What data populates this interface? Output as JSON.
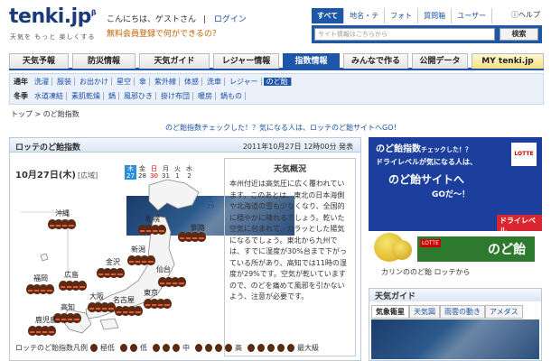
{
  "header": {
    "logo": "tenki.jp",
    "logo_beta": "β",
    "tagline": "天気を もっと 楽しくする",
    "greeting": "こんにちは、ゲストさん",
    "separator": "|",
    "login": "ログイン",
    "signup": "無料会員登録で何ができるの？",
    "help": "ヘルプ"
  },
  "search": {
    "tabs": [
      "すべて",
      "地名・テ",
      "フォト",
      "質問箱",
      "ユーザー"
    ],
    "placeholder": "サイト情報はこちらから",
    "button": "検索"
  },
  "nav": {
    "items": [
      "天気予報",
      "防災情報",
      "天気ガイド",
      "レジャー情報",
      "指数情報",
      "みんなで作る",
      "公開データ",
      "MY tenki.jp"
    ],
    "active": "指数情報"
  },
  "subnav": {
    "row1_lead": "通年",
    "row1": [
      "洗濯",
      "服装",
      "お出かけ",
      "星空",
      "傘",
      "紫外線",
      "体感",
      "洗車",
      "レジャー",
      "のど飴"
    ],
    "row1_active": "のど飴",
    "row2_lead": "冬季",
    "row2": [
      "水道凍結",
      "素肌乾燥",
      "鍋",
      "風邪ひき",
      "掛け布団",
      "暖房",
      "鍋もの"
    ]
  },
  "breadcrumb": "トップ > のど飴指数",
  "promo_link": "のど飴指数チェックした！？気になる人は、ロッテのど飴サイトへGO！",
  "panel": {
    "title": "ロッテのど飴指数",
    "issued": "2011年10月27日 12時00分 発表",
    "map_date": "10月27日(木)",
    "map_loc": "[広域]",
    "days": [
      {
        "wd": "木",
        "d": "27",
        "type": "today"
      },
      {
        "wd": "金",
        "d": "28",
        "type": ""
      },
      {
        "wd": "土",
        "d": "29",
        "type": "sat"
      },
      {
        "wd": "日",
        "d": "30",
        "type": "sun"
      },
      {
        "wd": "月",
        "d": "31",
        "type": ""
      },
      {
        "wd": "火",
        "d": "1",
        "type": ""
      },
      {
        "wd": "水",
        "d": "2",
        "type": ""
      }
    ],
    "cities": [
      {
        "name": "沖縄",
        "level": 4
      },
      {
        "name": "札幌",
        "level": 4
      },
      {
        "name": "釧路",
        "level": 4
      },
      {
        "name": "新潟",
        "level": 4
      },
      {
        "name": "金沢",
        "level": 4
      },
      {
        "name": "広島",
        "level": 4
      },
      {
        "name": "福岡",
        "level": 4
      },
      {
        "name": "仙台",
        "level": 4
      },
      {
        "name": "東京",
        "level": 4
      },
      {
        "name": "大阪",
        "level": 4
      },
      {
        "name": "名古屋",
        "level": 4
      },
      {
        "name": "高知",
        "level": 4
      },
      {
        "name": "鹿児島",
        "level": 4
      }
    ],
    "legend_label": "ロッテのど飴指数凡例",
    "legend": [
      "極低",
      "低",
      "中",
      "高",
      "最大級"
    ],
    "summary_title": "天気概況",
    "summary_body": "本州付近は高気圧に広く覆われています。このあとは、東北の日本海側や北海道の雪も少なくなり、全国的に穏やかに晴れるでしょう。乾いた空気に包まれて、カラッとした陽気になるでしょう。東北から九州では、すでに湿度が30%台まで下がっている所があり、高知では11時の湿度が29%です。空気が乾いていますので、のどを痛めて風邪を引かないよう、注意が必要です。"
  },
  "ad": {
    "line1": "のど飴指数",
    "line1_small": "チェックした！？",
    "line2": "ドライレベルが気になる人は、",
    "line3": "のど飴サイトへ",
    "go": "GOだ～！",
    "brand": "LOTTE",
    "dry": "ドライレベル",
    "pack_tag": "LOTTE",
    "pack_name": "のど飴",
    "caption": "カリンののど飴 ロッテから"
  },
  "weather_guide": {
    "title": "天気ガイド",
    "tabs": [
      "気象衛星",
      "天気図",
      "雨雲の動き",
      "アメダス"
    ],
    "active": "気象衛星"
  }
}
